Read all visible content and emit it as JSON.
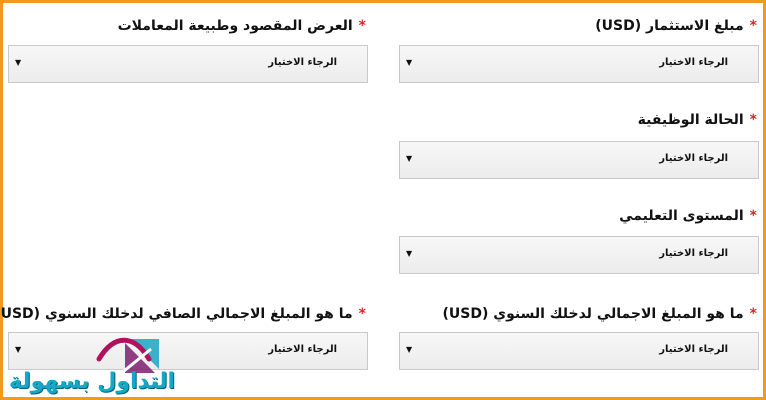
{
  "required_marker": "*",
  "fields": [
    {
      "label": "مبلغ الاستثمار (USD)",
      "value": "الرجاء الاختيار"
    },
    {
      "label": "الحالة الوظيفية",
      "value": "الرجاء الاختيار"
    },
    {
      "label": "المستوى التعليمي",
      "value": "الرجاء الاختيار"
    },
    {
      "label": "ما هو المبلغ الاجمالي لدخلك السنوي (USD)",
      "value": "الرجاء الاختيار"
    },
    {
      "label": "العرض المقصود وطبيعة المعاملات",
      "value": "الرجاء الاختيار"
    },
    {
      "label": "ما هو المبلغ الاجمالي الصافي لدخلك السنوي (USD)",
      "value": "الرجاء الاختيار"
    }
  ],
  "logo": {
    "text": "التداول بسهولة",
    "icon": "trading-logo-icon"
  },
  "colors": {
    "border": "#f39a1e",
    "required": "#d9252b",
    "logo_blue": "#12a8c7",
    "logo_magenta": "#b0125e"
  }
}
